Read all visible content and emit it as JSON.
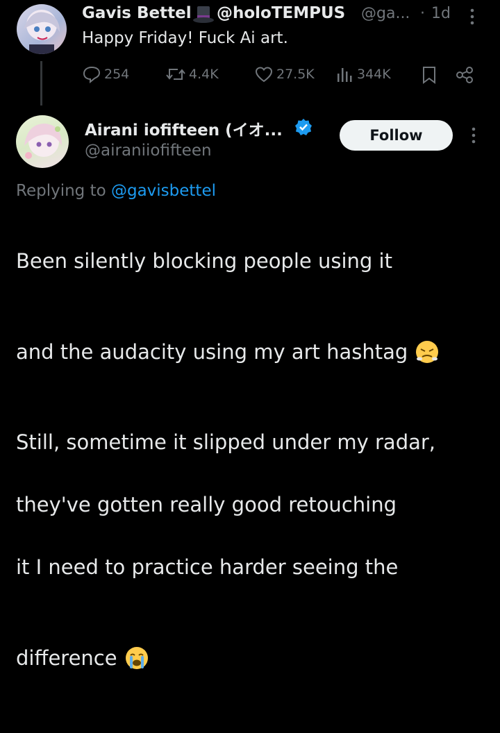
{
  "parent_tweet": {
    "display_name": "Gavis Bettel",
    "name_suffix": "@holoTEMPUS",
    "handle": "@ga...",
    "time_sep": "·",
    "time": "1d",
    "text": "Happy Friday! Fuck Ai art.",
    "stats": {
      "replies": "254",
      "retweets": "4.4K",
      "likes": "27.5K",
      "views": "344K"
    }
  },
  "reply_tweet": {
    "display_name": "Airani iofifteen (イオ...",
    "handle": "@airaniiofifteen",
    "follow_label": "Follow",
    "replying_prefix": "Replying to",
    "replying_handle": "@gavisbettel",
    "text_lines": [
      "Been silently blocking people using it",
      "and the audacity using my art hashtag",
      "Still, sometime it slipped under my radar,",
      "they've gotten really good retouching",
      "it I need to practice harder seeing the",
      "difference"
    ]
  },
  "colors": {
    "accent": "#1d9bf0",
    "muted": "#71767b",
    "text": "#e7e9ea",
    "background": "#000000",
    "follow_bg": "#eff3f4"
  }
}
